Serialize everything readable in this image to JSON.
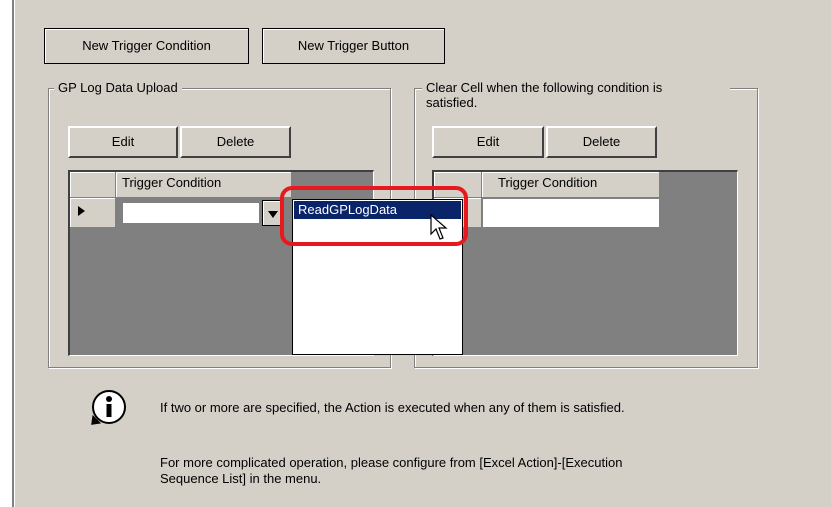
{
  "toolbar": {
    "new_trigger_condition": "New Trigger Condition",
    "new_trigger_button": "New Trigger Button"
  },
  "left_group": {
    "legend": "GP Log Data Upload",
    "edit_label": "Edit",
    "delete_label": "Delete",
    "column_header": "Trigger Condition",
    "row_value": ""
  },
  "right_group": {
    "legend_line1": "Clear Cell when the following condition is",
    "legend_line2": "satisfied.",
    "edit_label": "Edit",
    "delete_label": "Delete",
    "column_header": "Trigger Condition",
    "row_value": ""
  },
  "dropdown": {
    "options": [
      "ReadGPLogData"
    ],
    "highlighted": "ReadGPLogData"
  },
  "info": {
    "icon": "info-icon",
    "line1": "If two or more are specified, the Action is executed when any of them is satisfied.",
    "line2": "For more complicated operation, please configure from [Excel Action]-[Execution",
    "line3": "Sequence List] in the menu."
  },
  "colors": {
    "face": "#d4d0c8",
    "highlight": "#0a246a",
    "callout": "#e8191e"
  }
}
